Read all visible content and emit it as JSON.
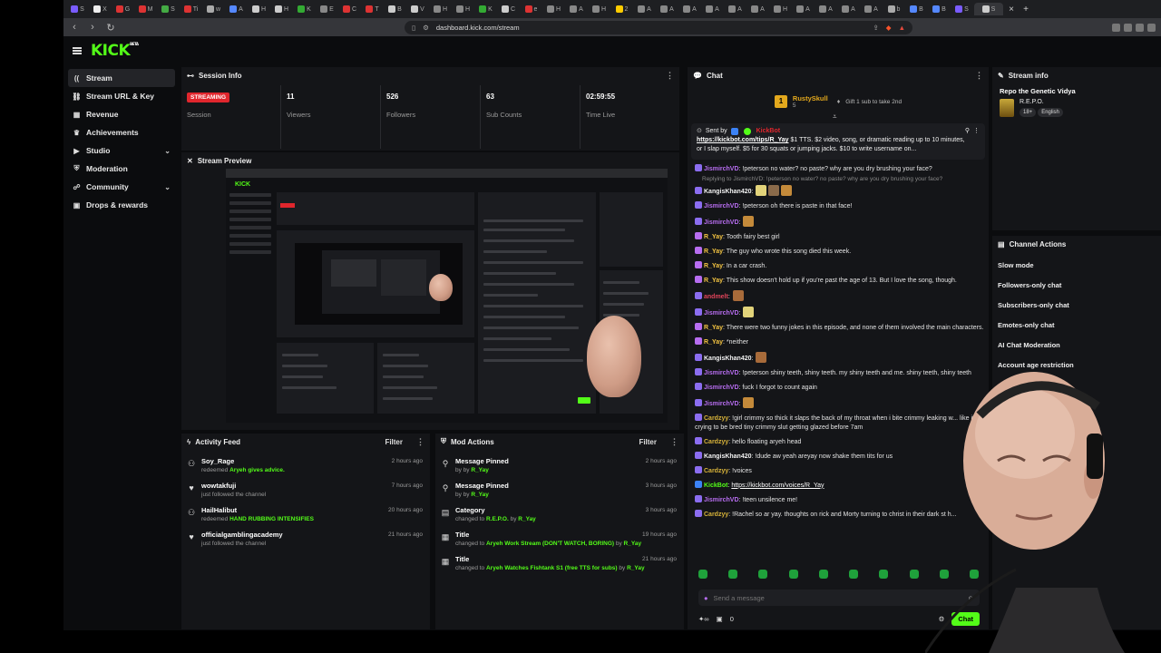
{
  "browser": {
    "url": "dashboard.kick.com/stream",
    "tabs": [
      "S",
      "X",
      "G",
      "M",
      "S",
      "Ti",
      "w",
      "A",
      "H",
      "H",
      "K",
      "E",
      "C",
      "T",
      "B",
      "V",
      "H",
      "H",
      "K",
      "C",
      "e",
      "H",
      "A",
      "H",
      "2",
      "A",
      "A",
      "A",
      "A",
      "A",
      "A",
      "H",
      "A",
      "A",
      "A",
      "A",
      "b",
      "B",
      "B",
      "S",
      "S"
    ]
  },
  "brand": {
    "logo": "KICK",
    "beta": "BETA"
  },
  "sidebar": {
    "items": [
      {
        "label": "Stream",
        "icon": "broadcast-icon"
      },
      {
        "label": "Stream URL & Key",
        "icon": "link-icon"
      },
      {
        "label": "Revenue",
        "icon": "revenue-icon"
      },
      {
        "label": "Achievements",
        "icon": "trophy-icon"
      },
      {
        "label": "Studio",
        "icon": "studio-icon"
      },
      {
        "label": "Moderation",
        "icon": "shield-icon"
      },
      {
        "label": "Community",
        "icon": "community-icon"
      },
      {
        "label": "Drops & rewards",
        "icon": "gift-icon"
      }
    ]
  },
  "session": {
    "title": "Session Info",
    "status_badge": "STREAMING",
    "stats": [
      {
        "value": "",
        "label": "Session"
      },
      {
        "value": "11",
        "label": "Viewers"
      },
      {
        "value": "526",
        "label": "Followers"
      },
      {
        "value": "63",
        "label": "Sub Counts"
      },
      {
        "value": "02:59:55",
        "label": "Time Live"
      }
    ]
  },
  "preview": {
    "title": "Stream Preview"
  },
  "activity": {
    "title": "Activity Feed",
    "filter": "Filter",
    "items": [
      {
        "name": "Soy_Rage",
        "action": "redeemed",
        "highlight": "Aryeh gives advice.",
        "time": "2 hours ago",
        "icon": "redeem-icon"
      },
      {
        "name": "wowtakfuji",
        "action": "just followed the channel",
        "highlight": "",
        "time": "7 hours ago",
        "icon": "heart-icon"
      },
      {
        "name": "HailHalibut",
        "action": "redeemed",
        "highlight": "HAND RUBBING INTENSIFIES",
        "time": "20 hours ago",
        "icon": "redeem-icon"
      },
      {
        "name": "officialgamblingacademy",
        "action": "just followed the channel",
        "highlight": "",
        "time": "21 hours ago",
        "icon": "heart-icon"
      }
    ]
  },
  "mod": {
    "title": "Mod Actions",
    "filter": "Filter",
    "items": [
      {
        "name": "Message Pinned",
        "pre": "by",
        "detail": "",
        "by": "R_Yay",
        "time": "2 hours ago",
        "icon": "pin-icon"
      },
      {
        "name": "Message Pinned",
        "pre": "by",
        "detail": "",
        "by": "R_Yay",
        "time": "3 hours ago",
        "icon": "pin-icon"
      },
      {
        "name": "Category",
        "pre": "changed to",
        "detail": "R.E.P.O.",
        "by": "R_Yay",
        "time": "3 hours ago",
        "icon": "category-icon"
      },
      {
        "name": "Title",
        "pre": "changed to",
        "detail": "Aryeh Work Stream (DON'T WATCH, BORING)",
        "by": "R_Yay",
        "time": "19 hours ago",
        "icon": "title-icon"
      },
      {
        "name": "Title",
        "pre": "changed to",
        "detail": "Aryeh Watches Fishtank S1 (free TTS for subs)",
        "by": "R_Yay",
        "time": "21 hours ago",
        "icon": "title-icon"
      }
    ]
  },
  "chat": {
    "title": "Chat",
    "top_gifter": {
      "name": "RustySkull",
      "count": "5",
      "note": "Gift 1 sub to take 2nd"
    },
    "pinned": {
      "sent_by_label": "Sent by",
      "sender": "KickBot",
      "link": "https://kickbot.com/tips/R_Yay",
      "text": " $1 TTS. $2 video, song, or dramatic reading up to 10 minutes, or I slap myself. $5 for 30 squats or jumping jacks. $10 to write username on..."
    },
    "messages": [
      {
        "user": "JismirchVD",
        "color": "#b76df0",
        "text": "!peterson no water? no paste? why are you dry brushing your face?"
      },
      {
        "reply": "Replying to JismirchVD: !peterson no water? no paste? why are you dry brushing your face?"
      },
      {
        "user": "KangisKhan420",
        "color": "#f2f2f2",
        "text": "",
        "emotes": 3
      },
      {
        "user": "JismirchVD",
        "color": "#b76df0",
        "text": "!peterson oh there is paste in that face!"
      },
      {
        "user": "JismirchVD",
        "color": "#b76df0",
        "text": "",
        "emotes": 1
      },
      {
        "user": "R_Yay",
        "color": "#f5c542",
        "text": "Tooth fairy best girl"
      },
      {
        "user": "R_Yay",
        "color": "#f5c542",
        "text": "The guy who wrote this song died this week."
      },
      {
        "user": "R_Yay",
        "color": "#f5c542",
        "text": "In a car crash."
      },
      {
        "user": "R_Yay",
        "color": "#f5c542",
        "text": "This show doesn't hold up if you're past the age of 13. But I love the song, though."
      },
      {
        "user": "andmelt",
        "color": "#e0445a",
        "text": "",
        "emotes": 1
      },
      {
        "user": "JismirchVD",
        "color": "#b76df0",
        "text": "",
        "emotes": 1
      },
      {
        "user": "R_Yay",
        "color": "#f5c542",
        "text": "There were two funny jokes in this episode, and none of them involved the main characters."
      },
      {
        "user": "R_Yay",
        "color": "#f5c542",
        "text": "*neither"
      },
      {
        "user": "KangisKhan420",
        "color": "#f2f2f2",
        "text": "",
        "emotes": 1
      },
      {
        "user": "JismirchVD",
        "color": "#b76df0",
        "text": "!peterson shiny teeth, shiny teeth. my shiny teeth and me. shiny teeth, shiny teeth"
      },
      {
        "user": "JismirchVD",
        "color": "#b76df0",
        "text": "fuck I forgot to count again"
      },
      {
        "user": "JismirchVD",
        "color": "#b76df0",
        "text": "",
        "emotes": 1
      },
      {
        "user": "Cardzyy",
        "color": "#d9b43a",
        "text": "!girl crimmy so thick it slaps the back of my throat when i bite crimmy leaking w... like it's crying to be bred tiny crimmy slut getting glazed before 7am"
      },
      {
        "user": "Cardzyy",
        "color": "#d9b43a",
        "text": "hello floating aryeh head"
      },
      {
        "user": "KangisKhan420",
        "color": "#f2f2f2",
        "text": "!dude aw yeah areyay now shake them tits for us"
      },
      {
        "user": "Cardzyy",
        "color": "#d9b43a",
        "text": "!voices"
      },
      {
        "user": "KickBot",
        "color": "#53fc18",
        "text": "https://kickbot.com/voices/R_Yay"
      },
      {
        "user": "JismirchVD",
        "color": "#b76df0",
        "text": "!teen unsilence me!"
      },
      {
        "user": "Cardzyy",
        "color": "#d9b43a",
        "text": "!Rachel so ar yay. thoughts on rick and Morty turning to christ in their dark st h..."
      }
    ],
    "input_placeholder": "Send a message",
    "viewer_count": "0",
    "send_label": "Chat"
  },
  "stream_info": {
    "title": "Stream info",
    "stream_title": "Repo the Genetic Vidya",
    "category": "R.E.P.O.",
    "tags": [
      "18+",
      "English"
    ]
  },
  "channel_actions": {
    "title": "Channel Actions",
    "items": [
      "Slow mode",
      "Followers-only chat",
      "Subscribers-only chat",
      "Emotes-only chat",
      "AI Chat Moderation",
      "Account age restriction"
    ]
  },
  "colors": {
    "accent": "#53fc18",
    "live": "#e0262d",
    "panel": "#141518",
    "bg": "#0b0c0e"
  }
}
